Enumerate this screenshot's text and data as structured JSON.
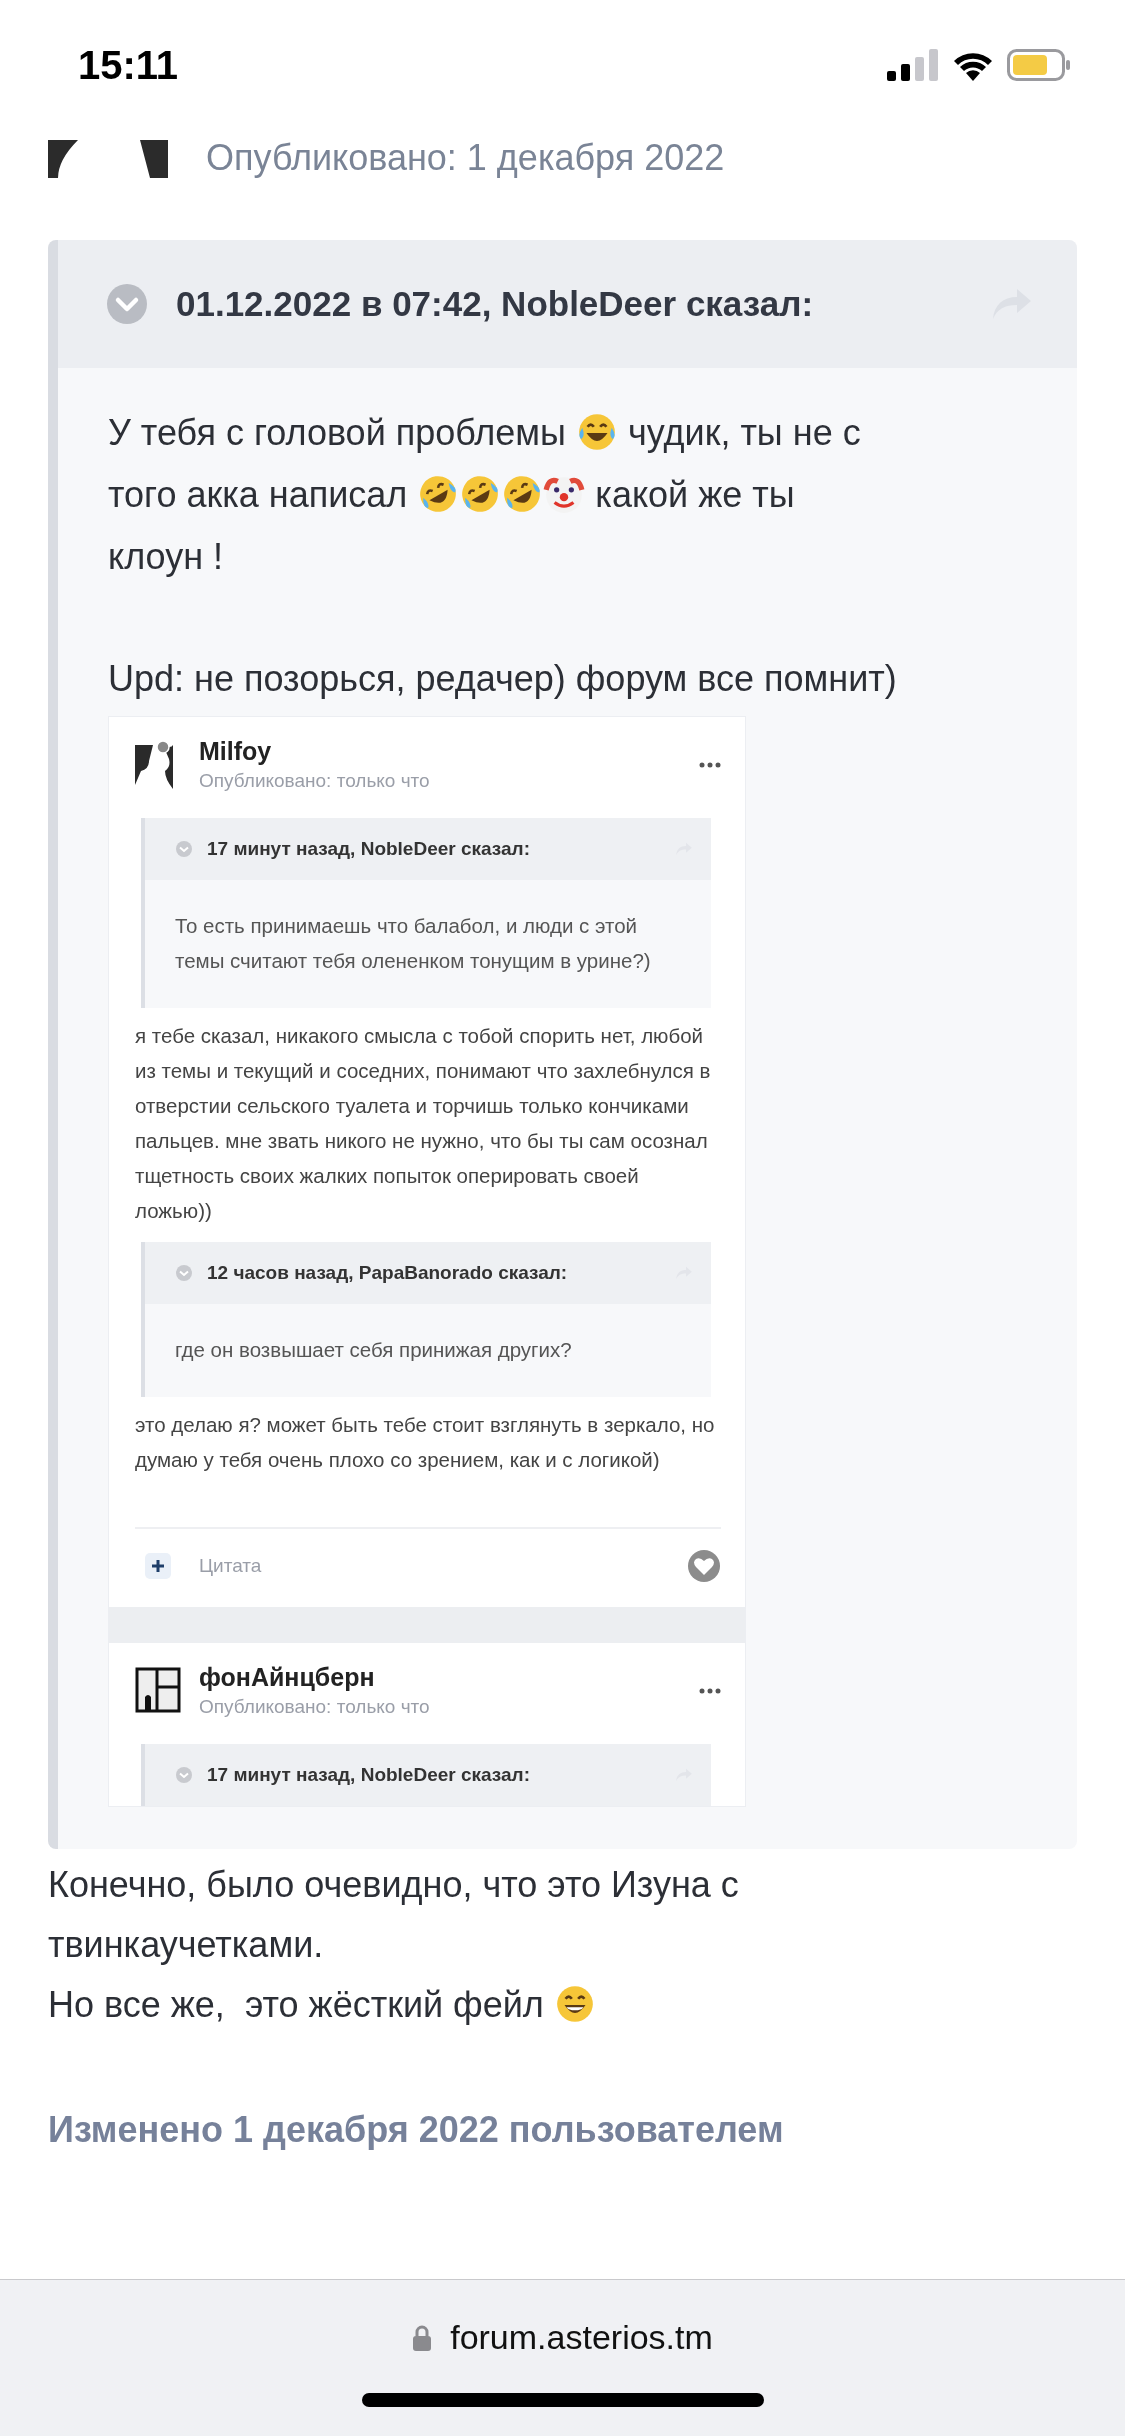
{
  "status_bar": {
    "time": "15:11"
  },
  "post": {
    "meta": "Опубликовано: 1 декабря 2022",
    "quote": {
      "header": "01.12.2022 в 07:42, NobleDeer сказал:",
      "paragraphs": [
        [
          [
            {
              "kind": "text",
              "text": "У тебя с головой проблемы "
            },
            {
              "kind": "laughing"
            },
            {
              "kind": "text",
              "text": " чудик, ты не с"
            }
          ],
          [
            {
              "kind": "text",
              "text": "того акка написал "
            },
            {
              "kind": "rolling"
            },
            {
              "kind": "rolling"
            },
            {
              "kind": "rolling"
            },
            {
              "kind": "clown"
            },
            {
              "kind": "text",
              "text": " какой же ты"
            }
          ],
          [
            {
              "kind": "text",
              "text": "клоун !"
            }
          ]
        ],
        [
          [
            {
              "kind": "text",
              "text": "Upd: не позорься, редачер) форум все помнит)"
            }
          ]
        ]
      ],
      "screenshot": {
        "posts": [
          {
            "author": "Milfoy",
            "meta": "Опубликовано: только что",
            "blocks": [
              {
                "kind": "quote",
                "header": "17 минут назад, NobleDeer сказал:",
                "text": "То есть принимаешь что балабол, и люди с этой темы считают тебя олененком тонущим в урине?)"
              },
              {
                "kind": "text",
                "text": "я тебе сказал, никакого смысла с тобой спорить нет, любой из темы и текущий и соседних, понимают что захлебнулся в отверстии сельского туалета и торчишь только кончиками пальцев. мне звать никого не нужно, что бы ты сам осознал тщетность своих жалких попыток оперировать своей ложью))"
              },
              {
                "kind": "quote",
                "header": "12 часов назад, PapaBanorado сказал:",
                "text": "где он возвышает себя принижая других?"
              },
              {
                "kind": "text",
                "text": "это делаю я? может быть тебе стоит взглянуть в зеркало, но думаю у тебя очень плохо со зрением, как и с логикой)"
              }
            ],
            "footer": {
              "quote_label": "Цитата"
            }
          },
          {
            "author": "фонАйнцберн",
            "meta": "Опубликовано: только что",
            "blocks": [
              {
                "kind": "quote-header",
                "header": "17 минут назад, NobleDeer сказал:"
              }
            ]
          }
        ]
      }
    },
    "paragraphs": [
      [
        [
          {
            "kind": "text",
            "text": "Конечно, было очевидно, что это Изуна с"
          }
        ],
        [
          {
            "kind": "text",
            "text": "твинкаучетками."
          }
        ]
      ],
      [
        [
          {
            "kind": "text",
            "text": "Но все же,  это жёсткий фейл "
          },
          {
            "kind": "grinning"
          }
        ]
      ]
    ],
    "edited": "Изменено 1 декабря 2022 пользователем"
  },
  "browser_bar": {
    "url": "forum.asterios.tm"
  }
}
